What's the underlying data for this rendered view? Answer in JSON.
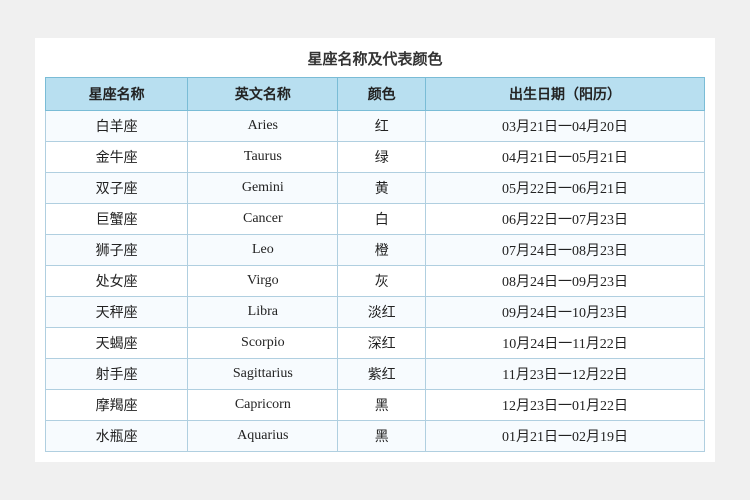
{
  "title": "星座名称及代表颜色",
  "headers": [
    "星座名称",
    "英文名称",
    "颜色",
    "出生日期（阳历）"
  ],
  "rows": [
    {
      "name": "白羊座",
      "english": "Aries",
      "color": "红",
      "dates": "03月21日一04月20日"
    },
    {
      "name": "金牛座",
      "english": "Taurus",
      "color": "绿",
      "dates": "04月21日一05月21日"
    },
    {
      "name": "双子座",
      "english": "Gemini",
      "color": "黄",
      "dates": "05月22日一06月21日"
    },
    {
      "name": "巨蟹座",
      "english": "Cancer",
      "color": "白",
      "dates": "06月22日一07月23日"
    },
    {
      "name": "狮子座",
      "english": "Leo",
      "color": "橙",
      "dates": "07月24日一08月23日"
    },
    {
      "name": "处女座",
      "english": "Virgo",
      "color": "灰",
      "dates": "08月24日一09月23日"
    },
    {
      "name": "天秤座",
      "english": "Libra",
      "color": "淡红",
      "dates": "09月24日一10月23日"
    },
    {
      "name": "天蝎座",
      "english": "Scorpio",
      "color": "深红",
      "dates": "10月24日一11月22日"
    },
    {
      "name": "射手座",
      "english": "Sagittarius",
      "color": "紫红",
      "dates": "11月23日一12月22日"
    },
    {
      "name": "摩羯座",
      "english": "Capricorn",
      "color": "黑",
      "dates": "12月23日一01月22日"
    },
    {
      "name": "水瓶座",
      "english": "Aquarius",
      "color": "黑",
      "dates": "01月21日一02月19日"
    }
  ]
}
